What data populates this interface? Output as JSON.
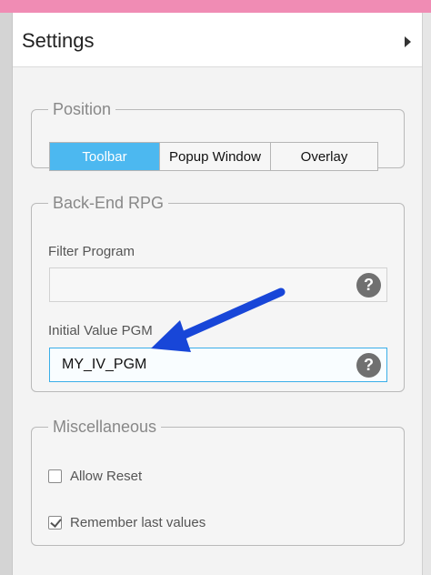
{
  "panel": {
    "title": "Settings"
  },
  "position": {
    "legend": "Position",
    "options": [
      "Toolbar",
      "Popup Window",
      "Overlay"
    ],
    "selected": "Toolbar"
  },
  "backend": {
    "legend": "Back-End RPG",
    "filter_program": {
      "label": "Filter Program",
      "value": "",
      "help_icon": "question-circle-icon"
    },
    "initial_value_pgm": {
      "label": "Initial Value PGM",
      "value": "MY_IV_PGM",
      "help_icon": "question-circle-icon"
    }
  },
  "misc": {
    "legend": "Miscellaneous",
    "allow_reset": {
      "label": "Allow Reset",
      "checked": false
    },
    "remember_last_values": {
      "label": "Remember last values",
      "checked": true
    }
  },
  "colors": {
    "accent": "#4cb8f0",
    "topbar": "#f08cb4",
    "annotation_arrow": "#1846d8"
  }
}
